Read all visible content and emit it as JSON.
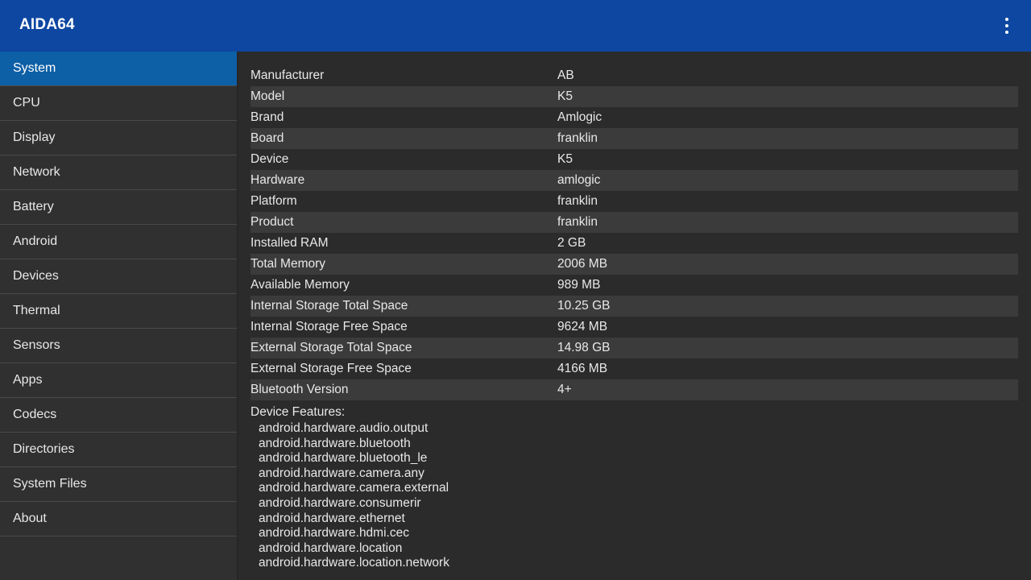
{
  "app": {
    "title": "AIDA64"
  },
  "sidebar": {
    "items": [
      {
        "label": "System"
      },
      {
        "label": "CPU"
      },
      {
        "label": "Display"
      },
      {
        "label": "Network"
      },
      {
        "label": "Battery"
      },
      {
        "label": "Android"
      },
      {
        "label": "Devices"
      },
      {
        "label": "Thermal"
      },
      {
        "label": "Sensors"
      },
      {
        "label": "Apps"
      },
      {
        "label": "Codecs"
      },
      {
        "label": "Directories"
      },
      {
        "label": "System Files"
      },
      {
        "label": "About"
      }
    ]
  },
  "system": {
    "rows": [
      {
        "key": "Manufacturer",
        "value": "AB"
      },
      {
        "key": "Model",
        "value": "K5"
      },
      {
        "key": "Brand",
        "value": "Amlogic"
      },
      {
        "key": "Board",
        "value": "franklin"
      },
      {
        "key": "Device",
        "value": "K5"
      },
      {
        "key": "Hardware",
        "value": "amlogic"
      },
      {
        "key": "Platform",
        "value": "franklin"
      },
      {
        "key": "Product",
        "value": "franklin"
      },
      {
        "key": "Installed RAM",
        "value": "2 GB"
      },
      {
        "key": "Total Memory",
        "value": "2006 MB"
      },
      {
        "key": "Available Memory",
        "value": "989 MB"
      },
      {
        "key": "Internal Storage Total Space",
        "value": "10.25 GB"
      },
      {
        "key": "Internal Storage Free Space",
        "value": "9624 MB"
      },
      {
        "key": "External Storage Total Space",
        "value": "14.98 GB"
      },
      {
        "key": "External Storage Free Space",
        "value": "4166 MB"
      },
      {
        "key": "Bluetooth Version",
        "value": "4+"
      }
    ],
    "features_label": "Device Features:",
    "features": [
      "android.hardware.audio.output",
      "android.hardware.bluetooth",
      "android.hardware.bluetooth_le",
      "android.hardware.camera.any",
      "android.hardware.camera.external",
      "android.hardware.consumerir",
      "android.hardware.ethernet",
      "android.hardware.hdmi.cec",
      "android.hardware.location",
      "android.hardware.location.network"
    ]
  }
}
